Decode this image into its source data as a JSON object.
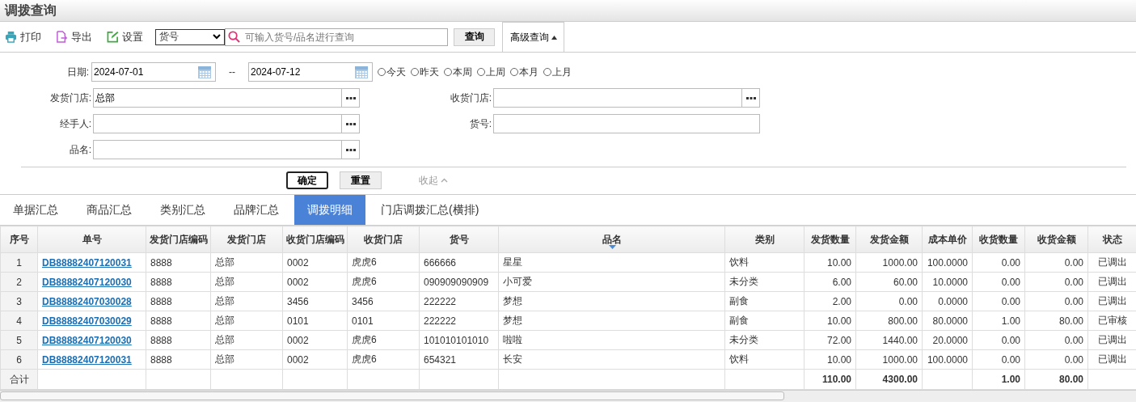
{
  "page_title": "调拨查询",
  "toolbar": {
    "buttons": [
      {
        "kind": "print",
        "label": "打印"
      },
      {
        "kind": "export",
        "label": "导出"
      },
      {
        "kind": "settings",
        "label": "设置"
      }
    ],
    "search_by": "货号",
    "search": {
      "placeholder": "可输入货号/品名进行查询"
    },
    "query_button": "查询",
    "advanced": {
      "label": "高级查询",
      "expanded": true
    }
  },
  "filters": {
    "date": {
      "label": "日期:",
      "from": "2024-07-01",
      "separator": "--",
      "to": "2024-07-12"
    },
    "quick_ranges": [
      {
        "label": "今天",
        "selected": false
      },
      {
        "label": "昨天",
        "selected": false
      },
      {
        "label": "本周",
        "selected": false
      },
      {
        "label": "上周",
        "selected": false
      },
      {
        "label": "本月",
        "selected": false
      },
      {
        "label": "上月",
        "selected": false
      }
    ],
    "fields": [
      {
        "label": "发货门店:",
        "value": "总部",
        "kind": "picker"
      },
      {
        "label": "收货门店:",
        "kind": "picker"
      },
      {
        "label": "经手人:",
        "kind": "picker"
      },
      {
        "label": "货号:",
        "kind": "plain"
      },
      {
        "label": "品名:",
        "kind": "picker"
      }
    ],
    "confirm": "确定",
    "reset": "重置",
    "collapse": "收起"
  },
  "tabs": [
    {
      "label": "单据汇总",
      "selected": false
    },
    {
      "label": "商品汇总",
      "selected": false
    },
    {
      "label": "类别汇总",
      "selected": false
    },
    {
      "label": "品牌汇总",
      "selected": false
    },
    {
      "label": "调拨明细",
      "selected": true
    },
    {
      "label": "门店调拨汇总(横排)",
      "selected": false
    }
  ],
  "table": {
    "columns": [
      {
        "label": "序号",
        "kind": "index",
        "sorted": false
      },
      {
        "label": "单号",
        "kind": "link",
        "sorted": false
      },
      {
        "label": "发货门店编码",
        "kind": "text",
        "sorted": false
      },
      {
        "label": "发货门店",
        "kind": "text",
        "sorted": false
      },
      {
        "label": "收货门店编码",
        "kind": "text",
        "sorted": false
      },
      {
        "label": "收货门店",
        "kind": "text",
        "sorted": false
      },
      {
        "label": "货号",
        "kind": "text",
        "sorted": false
      },
      {
        "label": "品名",
        "kind": "text",
        "sorted": true
      },
      {
        "label": "类别",
        "kind": "text",
        "sorted": false
      },
      {
        "label": "发货数量",
        "kind": "number",
        "sorted": false,
        "total": "110.00"
      },
      {
        "label": "发货金额",
        "kind": "number",
        "sorted": false,
        "total": "4300.00"
      },
      {
        "label": "成本单价",
        "kind": "number",
        "sorted": false
      },
      {
        "label": "收货数量",
        "kind": "number",
        "sorted": false,
        "total": "1.00"
      },
      {
        "label": "收货金额",
        "kind": "number",
        "sorted": false,
        "total": "80.00"
      },
      {
        "label": "状态",
        "kind": "status",
        "sorted": false
      }
    ],
    "rows": [
      [
        "1",
        "DB88882407120031",
        "8888",
        "总部",
        "0002",
        "虎虎6",
        "666666",
        "星星",
        "饮料",
        "10.00",
        "1000.00",
        "100.0000",
        "0.00",
        "0.00",
        "已调出"
      ],
      [
        "2",
        "DB88882407120030",
        "8888",
        "总部",
        "0002",
        "虎虎6",
        "090909090909",
        "小可爱",
        "未分类",
        "6.00",
        "60.00",
        "10.0000",
        "0.00",
        "0.00",
        "已调出"
      ],
      [
        "3",
        "DB88882407030028",
        "8888",
        "总部",
        "3456",
        "3456",
        "222222",
        "梦想",
        "副食",
        "2.00",
        "0.00",
        "0.0000",
        "0.00",
        "0.00",
        "已调出"
      ],
      [
        "4",
        "DB88882407030029",
        "8888",
        "总部",
        "0101",
        "0101",
        "222222",
        "梦想",
        "副食",
        "10.00",
        "800.00",
        "80.0000",
        "1.00",
        "80.00",
        "已审核"
      ],
      [
        "5",
        "DB88882407120030",
        "8888",
        "总部",
        "0002",
        "虎虎6",
        "101010101010",
        "啦啦",
        "未分类",
        "72.00",
        "1440.00",
        "20.0000",
        "0.00",
        "0.00",
        "已调出"
      ],
      [
        "6",
        "DB88882407120031",
        "8888",
        "总部",
        "0002",
        "虎虎6",
        "654321",
        "长安",
        "饮料",
        "10.00",
        "1000.00",
        "100.0000",
        "0.00",
        "0.00",
        "已调出"
      ]
    ],
    "total_label": "合计"
  }
}
